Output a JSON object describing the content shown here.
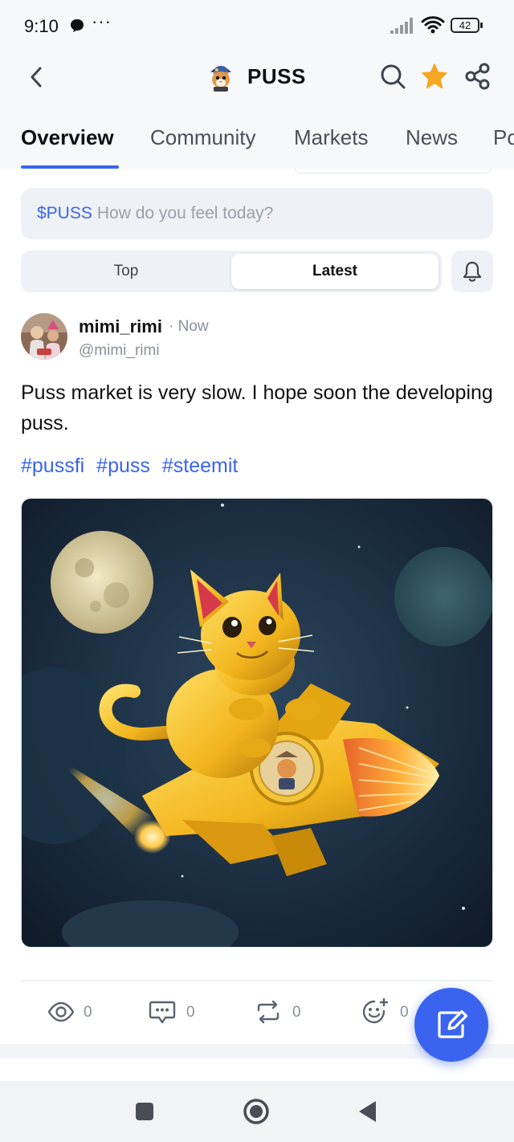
{
  "status_bar": {
    "time": "9:10",
    "more": "···",
    "battery": "42"
  },
  "header": {
    "title": "PUSS"
  },
  "tabs": [
    {
      "label": "Overview",
      "active": true
    },
    {
      "label": "Community",
      "active": false
    },
    {
      "label": "Markets",
      "active": false
    },
    {
      "label": "News",
      "active": false
    },
    {
      "label": "Po",
      "active": false
    }
  ],
  "composer": {
    "ticker": "$PUSS",
    "placeholder": "How do you feel today?"
  },
  "sort": {
    "top_label": "Top",
    "latest_label": "Latest",
    "selected": "Latest"
  },
  "post": {
    "author_name": "mimi_rimi",
    "time": "· Now",
    "handle": "@mimi_rimi",
    "text": "Puss market is very slow. I hope soon the developing puss.",
    "tags": [
      "#pussfi",
      "#puss",
      "#steemit"
    ],
    "actions": {
      "views": "0",
      "comments": "0",
      "reposts": "0",
      "reactions": "0"
    }
  },
  "colors": {
    "accent": "#3a64f0",
    "star": "#f5a623",
    "muted": "#8a909a"
  },
  "icons": [
    "back-arrow-icon",
    "search-icon",
    "star-icon",
    "share-icon",
    "bell-icon",
    "eye-icon",
    "comment-icon",
    "repost-icon",
    "add-reaction-icon",
    "compose-icon"
  ]
}
